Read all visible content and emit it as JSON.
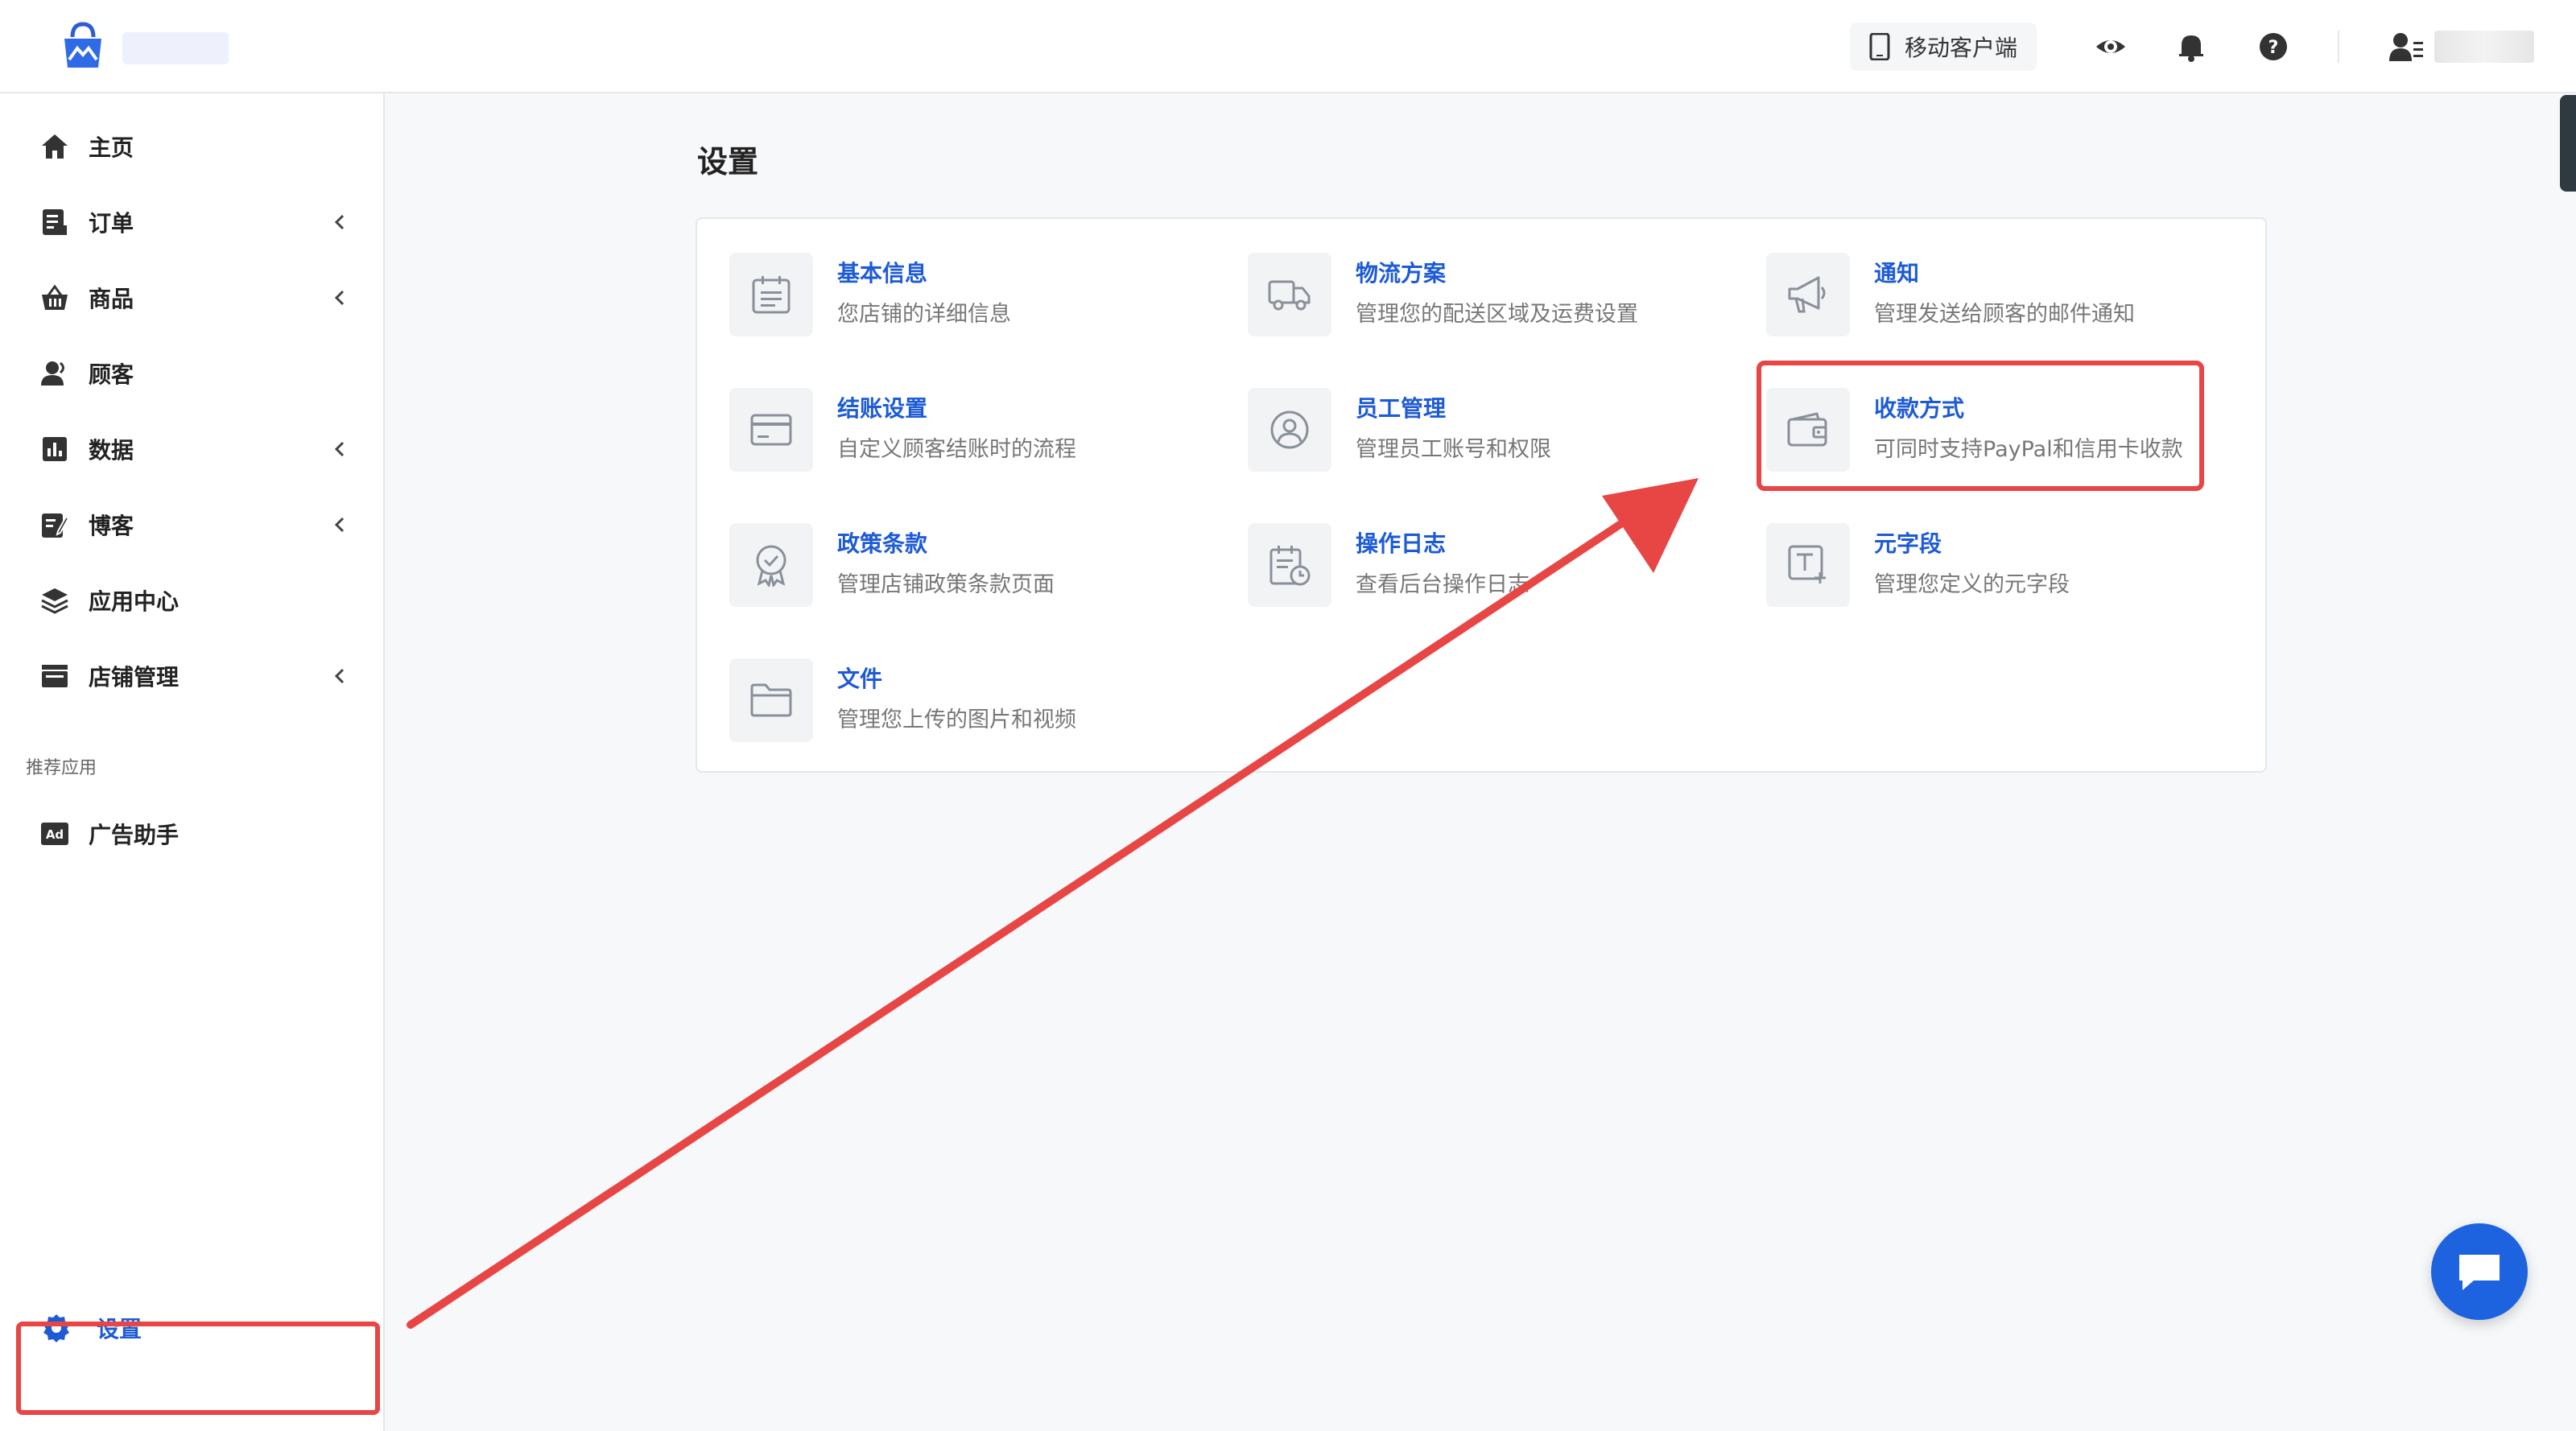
{
  "header": {
    "mobile_client_label": "移动客户端"
  },
  "sidebar": {
    "items": [
      {
        "label": "主页",
        "icon": "home-icon",
        "has_chevron": false
      },
      {
        "label": "订单",
        "icon": "order-icon",
        "has_chevron": true
      },
      {
        "label": "商品",
        "icon": "basket-icon",
        "has_chevron": true
      },
      {
        "label": "顾客",
        "icon": "customer-icon",
        "has_chevron": false
      },
      {
        "label": "数据",
        "icon": "chart-icon",
        "has_chevron": true
      },
      {
        "label": "博客",
        "icon": "blog-icon",
        "has_chevron": true
      },
      {
        "label": "应用中心",
        "icon": "layers-icon",
        "has_chevron": false
      },
      {
        "label": "店铺管理",
        "icon": "store-icon",
        "has_chevron": true
      }
    ],
    "recommended_section_label": "推荐应用",
    "recommended_items": [
      {
        "label": "广告助手",
        "icon": "ad-icon"
      }
    ],
    "settings_label": "设置"
  },
  "main": {
    "page_title": "设置",
    "tiles": [
      {
        "title": "基本信息",
        "desc": "您店铺的详细信息",
        "icon": "calendar-list-icon"
      },
      {
        "title": "物流方案",
        "desc": "管理您的配送区域及运费设置",
        "icon": "truck-icon"
      },
      {
        "title": "通知",
        "desc": "管理发送给顾客的邮件通知",
        "icon": "megaphone-icon"
      },
      {
        "title": "结账设置",
        "desc": "自定义顾客结账时的流程",
        "icon": "credit-card-icon"
      },
      {
        "title": "员工管理",
        "desc": "管理员工账号和权限",
        "icon": "user-circle-icon"
      },
      {
        "title": "收款方式",
        "desc": "可同时支持PayPal和信用卡收款",
        "icon": "wallet-icon"
      },
      {
        "title": "政策条款",
        "desc": "管理店铺政策条款页面",
        "icon": "badge-icon"
      },
      {
        "title": "操作日志",
        "desc": "查看后台操作日志",
        "icon": "log-clock-icon"
      },
      {
        "title": "元字段",
        "desc": "管理您定义的元字段",
        "icon": "text-plus-icon"
      },
      {
        "title": "文件",
        "desc": "管理您上传的图片和视频",
        "icon": "folder-icon"
      }
    ]
  },
  "colors": {
    "accent": "#1d5bd6",
    "annotation_red": "#e84545",
    "chat_button": "#1d63e0"
  }
}
